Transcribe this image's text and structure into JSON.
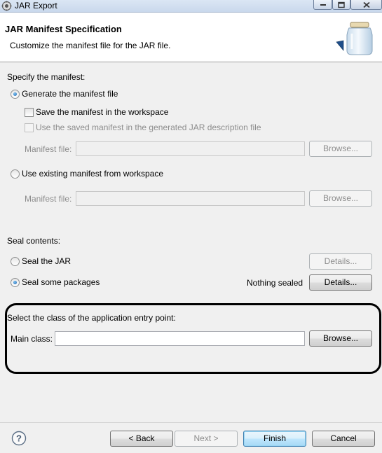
{
  "window": {
    "title": "JAR Export"
  },
  "header": {
    "title": "JAR Manifest Specification",
    "description": "Customize the manifest file for the JAR file."
  },
  "manifest": {
    "section_label": "Specify the manifest:",
    "generate_label": "Generate the manifest file",
    "generate_selected": true,
    "save_in_workspace_label": "Save the manifest in the workspace",
    "save_in_workspace_checked": false,
    "use_saved_label": "Use the saved manifest in the generated JAR description file",
    "use_saved_checked": false,
    "manifest_file_label_1": "Manifest file:",
    "manifest_file_value_1": "",
    "browse_label_1": "Browse...",
    "use_existing_label": "Use existing manifest from workspace",
    "use_existing_selected": false,
    "manifest_file_label_2": "Manifest file:",
    "manifest_file_value_2": "",
    "browse_label_2": "Browse..."
  },
  "seal": {
    "section_label": "Seal contents:",
    "seal_jar_label": "Seal the JAR",
    "seal_jar_selected": false,
    "details_label_1": "Details...",
    "seal_some_label": "Seal some packages",
    "seal_some_selected": true,
    "status_text": "Nothing sealed",
    "details_label_2": "Details..."
  },
  "entry_point": {
    "section_label": "Select the class of the application entry point:",
    "main_class_label": "Main class:",
    "main_class_value": "",
    "browse_label": "Browse..."
  },
  "footer": {
    "help_icon": "question-mark-icon",
    "back_label": "< Back",
    "next_label": "Next >",
    "finish_label": "Finish",
    "cancel_label": "Cancel"
  },
  "colors": {
    "highlight_outline": "#000000",
    "default_button_border": "#3c7fb1",
    "disabled_text": "#8d8d8d"
  }
}
